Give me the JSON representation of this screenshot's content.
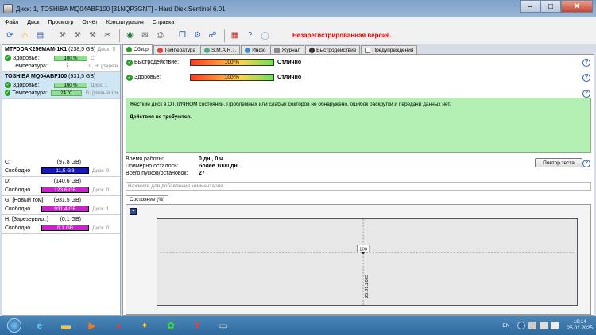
{
  "window": {
    "title": "Диск: 1, TOSHIBA MQ04ABF100 [31NQP3GNT]  -  Hard Disk Sentinel 6.01"
  },
  "menu": [
    "Файл",
    "Диск",
    "Просмотр",
    "Отчёт",
    "Конфигурация",
    "Справка"
  ],
  "toolbar": {
    "unregistered": "Незарегистрированная версия."
  },
  "disks": [
    {
      "name": "MTFDDAK256MAM-1K1",
      "size": "(238,5 GB)",
      "disk_label": "Диск: 0",
      "health_label": "Здоровье:",
      "health": "100 %",
      "health_note": "C:",
      "temp_label": "Температура:",
      "temp": "?",
      "temp_note": "D:, H: [Зарезе"
    },
    {
      "name": "TOSHIBA MQ04ABF100",
      "size": "(931,5 GB)",
      "disk_label": "",
      "health_label": "Здоровье:",
      "health": "100 %",
      "health_note": "Диск: 1",
      "temp_label": "Температура:",
      "temp": "24 °C",
      "temp_note": "G: [Новый том"
    }
  ],
  "volumes": [
    {
      "name": "C:",
      "size": "(97,8 GB)",
      "free_label": "Свободно",
      "free": "11,5 GB",
      "note": "Диск: 0"
    },
    {
      "name": "D:",
      "size": "(140,6 GB)",
      "free_label": "Свободно",
      "free": "123,6 GB",
      "note": "Диск: 0"
    },
    {
      "name": "G: [Новый том]",
      "size": "(931,5 GB)",
      "free_label": "Свободно",
      "free": "931,4 GB",
      "note": "Диск: 1"
    },
    {
      "name": "H: [Зарезервир..]",
      "size": "(0,1 GB)",
      "free_label": "Свободно",
      "free": "0,1 GB",
      "note": "Диск: 0"
    }
  ],
  "tabs": [
    "Обзор",
    "Температура",
    "S.M.A.R.T.",
    "Инфо",
    "Журнал",
    "Быстродействие",
    "Предупреждения"
  ],
  "overview": {
    "perf_label": "Быстродействие:",
    "perf_value": "100 %",
    "perf_status": "Отлично",
    "health_label": "Здоровье:",
    "health_value": "100 %",
    "health_status": "Отлично",
    "message": "Жесткий диск в ОТЛИЧНОМ состоянии. Проблемных или слабых секторов не обнаружено, ошибок раскрутки и передачи данных нет.",
    "action": "Действия не требуются.",
    "uptime_label": "Время работы:",
    "uptime": "0 дн., 0 ч",
    "remaining_label": "Примерно осталось:",
    "remaining": "более 1000 дн.",
    "starts_label": "Всего пусков/остановок:",
    "starts": "27",
    "retest_button": "Повтор теста",
    "comment_placeholder": "Нажмите для добавления комментария..."
  },
  "chart_tab": "Состояние (%)",
  "chart_data": {
    "type": "line",
    "x": [
      "25.01.2025"
    ],
    "series": [
      {
        "values": [
          100
        ]
      }
    ],
    "y_tick": "100",
    "point_label": "100"
  },
  "taskbar": {
    "lang": "EN",
    "time": "19:14",
    "date": "25.01.2025"
  }
}
